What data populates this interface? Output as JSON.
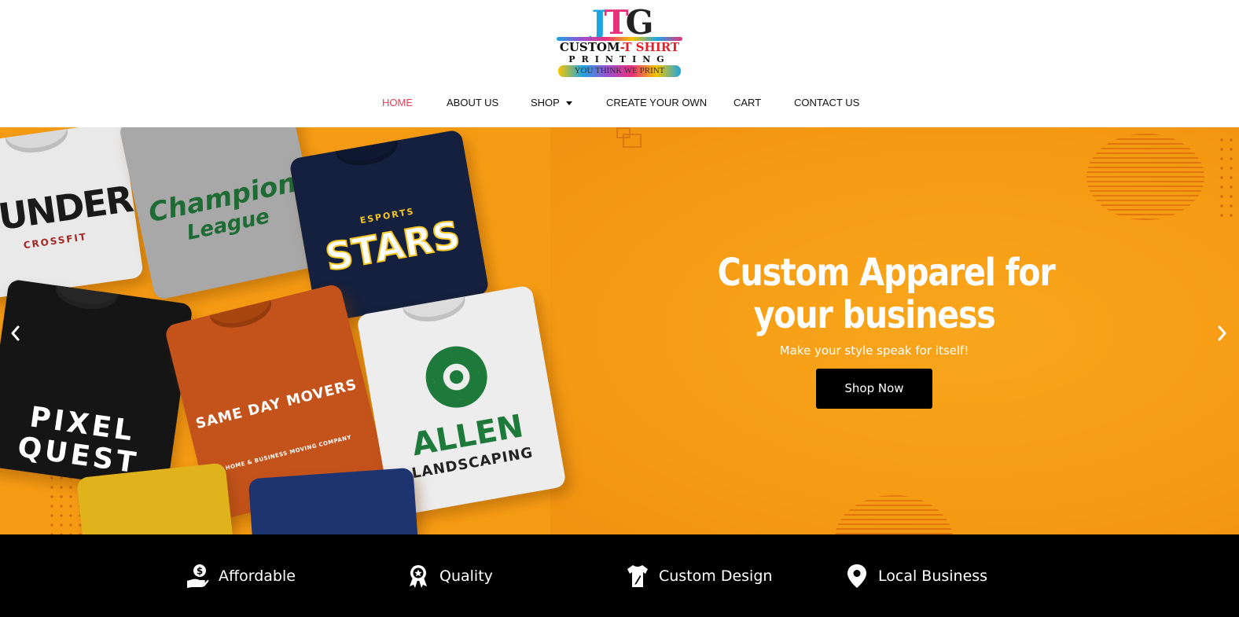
{
  "logo": {
    "monogram_j": "J",
    "monogram_t": "T",
    "monogram_g": "G",
    "line1_a": "CUSTOM",
    "line1_b": "-T SHIRT",
    "line2": "PRINTING",
    "tagline": "YOU THINK WE PRINT"
  },
  "nav": {
    "items": [
      {
        "label": "HOME",
        "active": true
      },
      {
        "label": "ABOUT US"
      },
      {
        "label": "SHOP",
        "has_dropdown": true
      },
      {
        "label": "CREATE YOUR OWN"
      },
      {
        "label": "CART"
      },
      {
        "label": "CONTACT US"
      }
    ],
    "active_color": "#e3425a"
  },
  "hero": {
    "background_color": "#f69c14",
    "title_line1": "Custom Apparel for",
    "title_line2": "your business",
    "subtitle": "Make your style speak for itself!",
    "cta_label": "Shop Now",
    "prev_arrow": "chevron-left-icon",
    "next_arrow": "chevron-right-icon",
    "shirts": [
      {
        "print_a": "HUNDER",
        "print_b": "CROSSFIT"
      },
      {
        "print_a": "Champion",
        "print_b": "League"
      },
      {
        "print_a": "ESPORTS",
        "print_b": "STARS"
      },
      {
        "print_a": "PIXEL",
        "print_b": "QUEST"
      },
      {
        "print_a": "SAME DAY MOVERS",
        "print_b": "HOME & BUSINESS MOVING COMPANY"
      },
      {
        "print_a": "ALLEN",
        "print_b": "LANDSCAPING"
      }
    ]
  },
  "features": [
    {
      "label": "Affordable",
      "icon": "money-hand-icon"
    },
    {
      "label": "Quality",
      "icon": "award-badge-icon"
    },
    {
      "label": "Custom Design",
      "icon": "tshirt-design-icon"
    },
    {
      "label": "Local Business",
      "icon": "map-pin-icon"
    }
  ]
}
